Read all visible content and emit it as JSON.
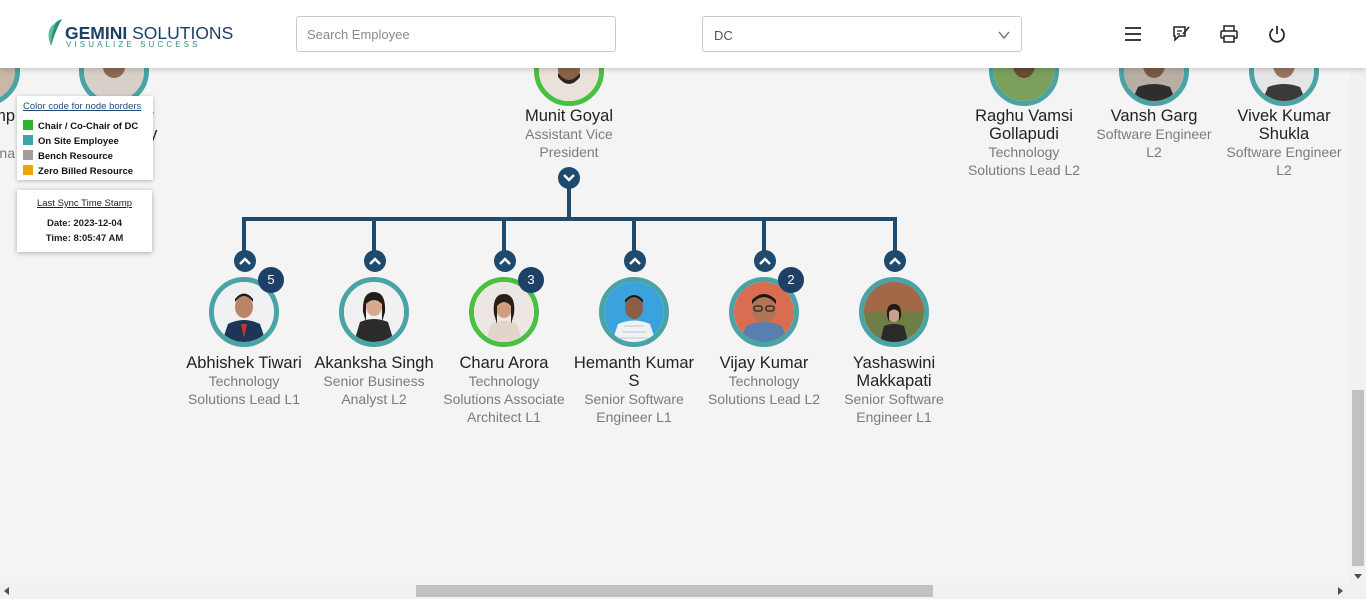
{
  "header": {
    "logo": {
      "name_bold": "GEMINI",
      "name_thin": "SOLUTIONS",
      "tagline": "VISUALIZE SUCCESS"
    },
    "search": {
      "placeholder": "Search Employee",
      "value": ""
    },
    "dc_select": {
      "selected": "DC"
    },
    "icons": [
      "menu-icon",
      "feedback-icon",
      "print-icon",
      "power-icon"
    ]
  },
  "chart": {
    "top_left_partial": [
      {
        "name_fragment": "mi mp",
        "role_fragment": "na"
      },
      {
        "name_fragment": "ry ny",
        "role_fragment": "re"
      }
    ],
    "root": {
      "name": "Munit Goyal",
      "role": "Assistant Vice President",
      "border": "green"
    },
    "top_right": [
      {
        "name": "Raghu Vamsi Gollapudi",
        "role": "Technology Solutions Lead L2"
      },
      {
        "name": "Vansh Garg",
        "role": "Software Engineer L2"
      },
      {
        "name": "Vivek Kumar Shukla",
        "role": "Software Engineer L2"
      }
    ],
    "children": [
      {
        "name": "Abhishek Tiwari",
        "role": "Technology Solutions Lead L1",
        "reports": "5",
        "border": "teal"
      },
      {
        "name": "Akanksha Singh",
        "role": "Senior Business Analyst L2",
        "reports": "",
        "border": "teal"
      },
      {
        "name": "Charu Arora",
        "role": "Technology Solutions Associate Architect L1",
        "reports": "3",
        "border": "green"
      },
      {
        "name": "Hemanth Kumar S",
        "role": "Senior Software Engineer L1",
        "reports": "",
        "border": "teal"
      },
      {
        "name": "Vijay Kumar",
        "role": "Technology Solutions Lead L2",
        "reports": "2",
        "border": "teal"
      },
      {
        "name": "Yashaswini Makkapati",
        "role": "Senior Software Engineer L1",
        "reports": "",
        "border": "teal"
      }
    ]
  },
  "legend": {
    "title": "Color code for node borders",
    "items": [
      {
        "label": "Chair / Co-Chair of DC",
        "color": "#2bb52b"
      },
      {
        "label": "On Site Employee",
        "color": "#3aa6a6"
      },
      {
        "label": "Bench Resource",
        "color": "#9e9e9e"
      },
      {
        "label": "Zero Billed Resource",
        "color": "#f0a30a"
      }
    ]
  },
  "sync": {
    "title": "Last Sync Time Stamp",
    "date_line": "Date: 2023-12-04",
    "time_line": "Time: 8:05:47 AM"
  },
  "colors": {
    "line": "#1e4a6e",
    "teal_border": "#4aa3a5",
    "green_border": "#49c043",
    "badge": "#1e3f66"
  }
}
